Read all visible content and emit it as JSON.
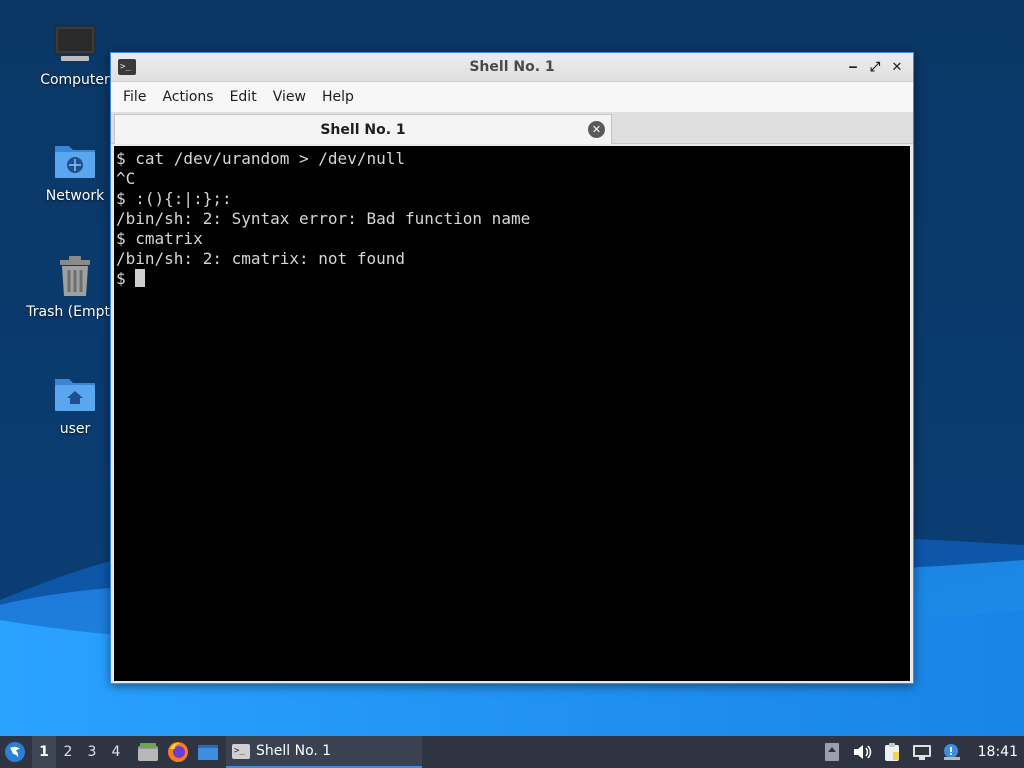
{
  "desktop": {
    "icons": [
      {
        "label": "Computer",
        "icon": "computer-icon"
      },
      {
        "label": "Network",
        "icon": "network-folder-icon"
      },
      {
        "label": "Trash (Empty)",
        "icon": "trash-icon"
      },
      {
        "label": "user",
        "icon": "home-folder-icon"
      }
    ]
  },
  "window": {
    "title": "Shell No. 1",
    "controls": {
      "minimize": "‒",
      "maximize": "⤢",
      "close": "✕"
    },
    "menu": [
      "File",
      "Actions",
      "Edit",
      "View",
      "Help"
    ],
    "tab": {
      "label": "Shell No. 1",
      "close": "✕"
    },
    "terminal_lines": [
      "$ cat /dev/urandom > /dev/null",
      "^C",
      "$ :(){:|:};:",
      "/bin/sh: 2: Syntax error: Bad function name",
      "$ cmatrix",
      "/bin/sh: 2: cmatrix: not found",
      "$ "
    ],
    "prompt_app_icon": ">_"
  },
  "taskbar": {
    "workspaces": [
      "1",
      "2",
      "3",
      "4"
    ],
    "active_workspace": "1",
    "launchers": [
      "file-manager-icon",
      "firefox-icon",
      "desktop-icon"
    ],
    "task": {
      "label": "Shell No. 1",
      "icon": ">_"
    },
    "tray": [
      "upload-arrow-icon",
      "volume-icon",
      "clipboard-icon",
      "network-display-icon",
      "update-notify-icon"
    ],
    "clock": "18:41"
  },
  "colors": {
    "accent": "#3d8ee0",
    "terminal_bg": "#000000",
    "terminal_fg": "#d6d6d6",
    "taskbar_bg": "#2e3442"
  }
}
